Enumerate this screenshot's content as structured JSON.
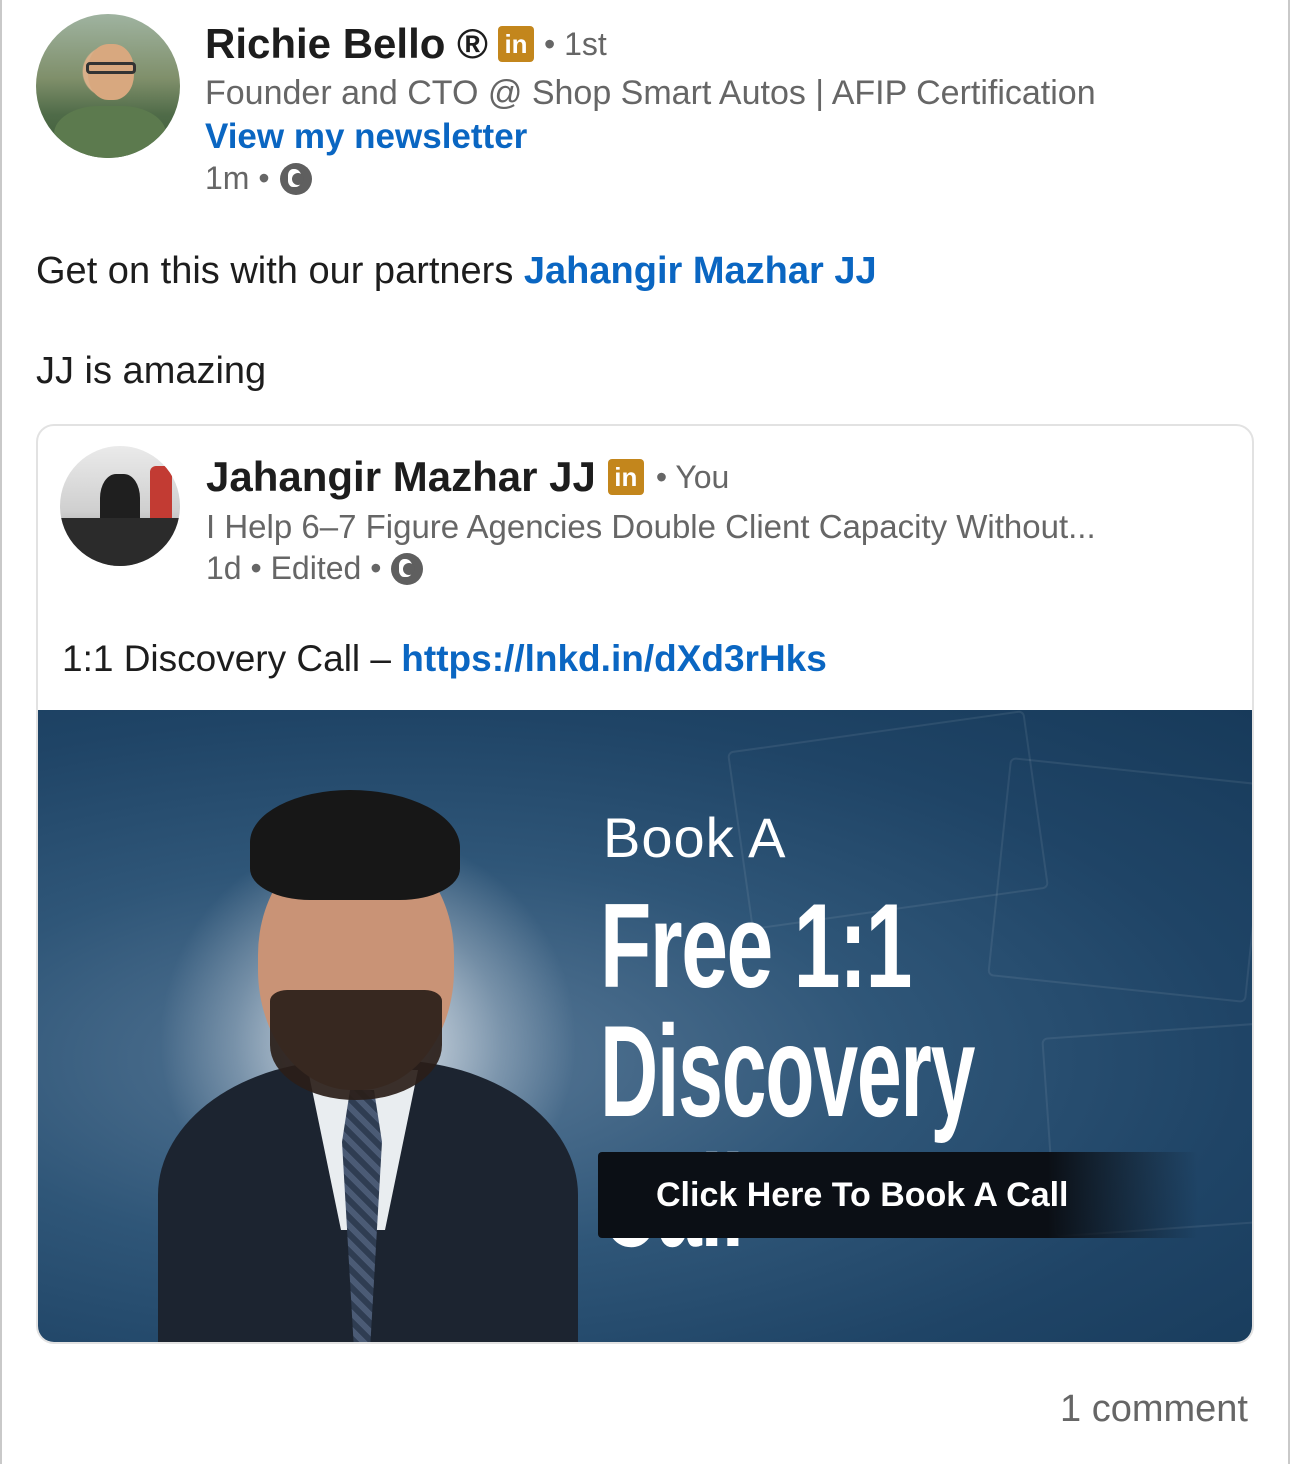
{
  "author": {
    "name": "Richie Bello ®",
    "badge": "in",
    "degree": "• 1st",
    "headline": "Founder and CTO @ Shop Smart Autos | AFIP Certification",
    "newsletter": "View my newsletter",
    "time": "1m •"
  },
  "post": {
    "line1_text": "Get on this with our partners ",
    "line1_mention": "Jahangir Mazhar JJ",
    "line2_text": "JJ is amazing"
  },
  "shared": {
    "name": "Jahangir Mazhar JJ",
    "badge": "in",
    "relation": "• You",
    "headline": "I Help 6–7 Figure Agencies Double Client Capacity Without...",
    "time": "1d • Edited •",
    "text": "1:1 Discovery Call – ",
    "link": "https://lnkd.in/dXd3rHks",
    "banner": {
      "line1": "Book A",
      "line2": "Free 1:1",
      "line3": "Discovery Call",
      "cta": "Click Here To Book A Call"
    }
  },
  "footer": {
    "comments": "1 comment"
  },
  "colors": {
    "link": "#0a66c2",
    "badge": "#c3861c",
    "muted": "#666666"
  },
  "icons": [
    "globe-icon",
    "linkedin-badge-icon"
  ]
}
